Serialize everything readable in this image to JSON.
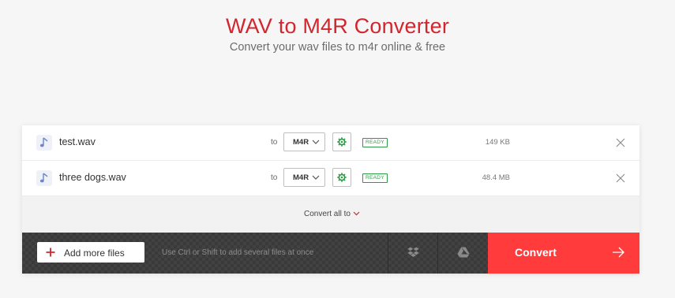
{
  "header": {
    "title": "WAV to M4R Converter",
    "subtitle": "Convert your wav files to m4r online & free"
  },
  "files": [
    {
      "icon": "music-note-icon",
      "name": "test.wav",
      "to_label": "to",
      "format": "M4R",
      "status": "READY",
      "size": "149 KB"
    },
    {
      "icon": "music-note-icon",
      "name": "three dogs.wav",
      "to_label": "to",
      "format": "M4R",
      "status": "READY",
      "size": "48.4 MB"
    }
  ],
  "convert_all": {
    "label": "Convert all to"
  },
  "actions": {
    "add_label": "Add more files",
    "hint": "Use Ctrl or Shift to add several files at once",
    "convert_label": "Convert",
    "dropbox_icon": "dropbox-icon",
    "gdrive_icon": "google-drive-icon"
  },
  "colors": {
    "accent": "#d2262f",
    "convert_bg": "#ff3b3b",
    "ready": "#2e9a48",
    "settings": "#2e9a48"
  }
}
